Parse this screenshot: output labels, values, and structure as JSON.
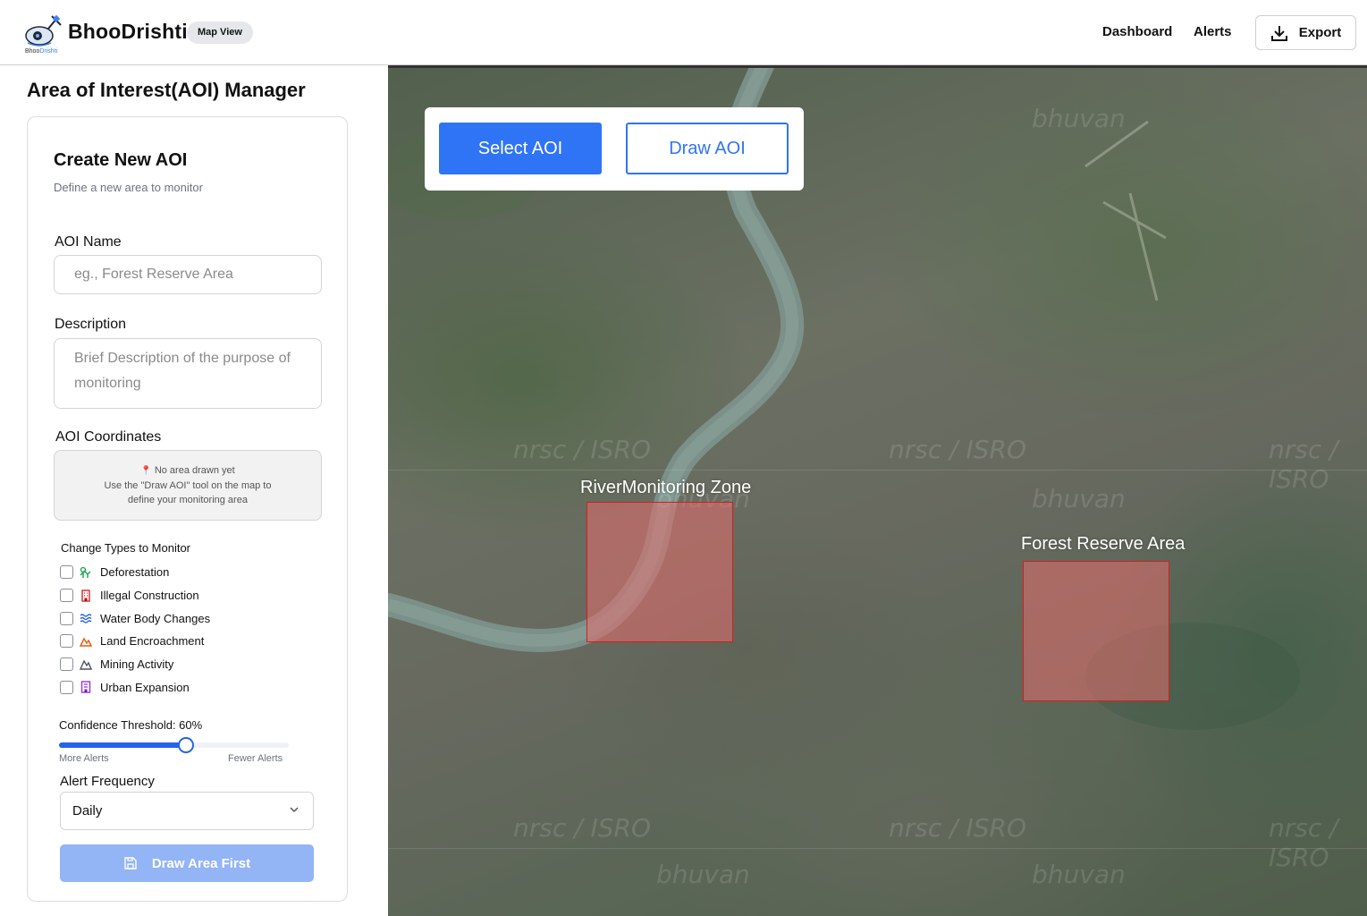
{
  "header": {
    "brand": "BhooDrishti",
    "logo_text_a": "Bhoo",
    "logo_text_b": "Drishti",
    "view_badge": "Map View",
    "nav": {
      "dashboard": "Dashboard",
      "alerts": "Alerts",
      "export": "Export"
    },
    "icons": {
      "export": "download-icon",
      "logo": "satellite-logo"
    }
  },
  "sidebar": {
    "title": "Area of Interest(AOI) Manager",
    "card": {
      "title": "Create New AOI",
      "subtitle": "Define a new area to monitor",
      "name_label": "AOI Name",
      "name_placeholder": "eg., Forest Reserve Area",
      "name_value": "",
      "description_label": "Description",
      "description_placeholder": "Brief Description of the purpose of monitoring",
      "description_value": "",
      "coords_label": "AOI Coordinates",
      "coords_empty_title": "No area drawn yet",
      "coords_empty_line1": "Use the \"Draw AOI\" tool on the map to",
      "coords_empty_line2": "define your monitoring area",
      "change_types_title": "Change Types to Monitor",
      "change_types": [
        {
          "label": "Deforestation",
          "icon": "tree-icon",
          "color": "#16a34a",
          "checked": false
        },
        {
          "label": "Illegal Construction",
          "icon": "building-icon",
          "color": "#dc2626",
          "checked": false
        },
        {
          "label": "Water Body Changes",
          "icon": "waves-icon",
          "color": "#2563eb",
          "checked": false
        },
        {
          "label": "Land Encroachment",
          "icon": "mountain-icon",
          "color": "#ea580c",
          "checked": false
        },
        {
          "label": "Mining Activity",
          "icon": "mountain-outline-icon",
          "color": "#4b5563",
          "checked": false
        },
        {
          "label": "Urban Expansion",
          "icon": "city-icon",
          "color": "#9333ea",
          "checked": false
        }
      ],
      "confidence_label": "Confidence Threshold: 60%",
      "confidence_value": 0.6,
      "slider_min_label": "More Alerts",
      "slider_max_label": "Fewer Alerts",
      "frequency_label": "Alert Frequency",
      "frequency_value": "Daily",
      "submit_label": "Draw Area First"
    }
  },
  "map": {
    "tools": {
      "select": "Select AOI",
      "draw": "Draw AOI"
    },
    "watermark_a": "nrsc / ISRO",
    "watermark_b": "bhuvan",
    "aois": [
      {
        "name": "RiverMonitoring Zone"
      },
      {
        "name": "Forest Reserve Area"
      }
    ]
  },
  "colors": {
    "accent": "#2f74f5",
    "aoi_fill": "#e66e6e",
    "aoi_border": "#d21f1f",
    "disabled_button": "#93b4f5"
  }
}
